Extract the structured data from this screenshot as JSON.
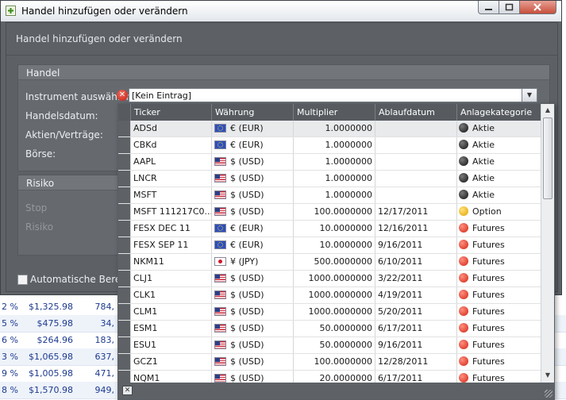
{
  "window": {
    "title": "Handel hinzufügen oder verändern",
    "header": "Handel hinzufügen oder verändern"
  },
  "groups": {
    "handel": {
      "title": "Handel",
      "instrument_label": "Instrument auswählen:",
      "date_label": "Handelsdatum:",
      "shares_label": "Aktien/Verträge:",
      "exchange_label": "Börse:"
    },
    "risiko": {
      "title": "Risiko",
      "stop_label": "Stop",
      "risk_label": "Risiko"
    }
  },
  "auto_calc_label": "Automatische Berechnu",
  "instrument_value": "[Kein Eintrag]",
  "columns": [
    "Ticker",
    "Währung",
    "Multiplier",
    "Ablaufdatum",
    "Anlagekategorie"
  ],
  "rows": [
    {
      "ticker": "ADSd",
      "flag": "eu",
      "currency": "€ (EUR)",
      "multiplier": "1.0000000",
      "expiry": "",
      "category": "Aktie",
      "cat_color": "black"
    },
    {
      "ticker": "CBKd",
      "flag": "eu",
      "currency": "€ (EUR)",
      "multiplier": "1.0000000",
      "expiry": "",
      "category": "Aktie",
      "cat_color": "black"
    },
    {
      "ticker": "AAPL",
      "flag": "us",
      "currency": "$ (USD)",
      "multiplier": "1.0000000",
      "expiry": "",
      "category": "Aktie",
      "cat_color": "black"
    },
    {
      "ticker": "LNCR",
      "flag": "us",
      "currency": "$ (USD)",
      "multiplier": "1.0000000",
      "expiry": "",
      "category": "Aktie",
      "cat_color": "black"
    },
    {
      "ticker": "MSFT",
      "flag": "us",
      "currency": "$ (USD)",
      "multiplier": "1.0000000",
      "expiry": "",
      "category": "Aktie",
      "cat_color": "black"
    },
    {
      "ticker": "MSFT  111217C0...",
      "flag": "us",
      "currency": "$ (USD)",
      "multiplier": "100.0000000",
      "expiry": "12/17/2011",
      "category": "Option",
      "cat_color": "yellow"
    },
    {
      "ticker": "FESX DEC 11",
      "flag": "eu",
      "currency": "€ (EUR)",
      "multiplier": "10.0000000",
      "expiry": "12/16/2011",
      "category": "Futures",
      "cat_color": "red"
    },
    {
      "ticker": "FESX SEP 11",
      "flag": "eu",
      "currency": "€ (EUR)",
      "multiplier": "10.0000000",
      "expiry": "9/16/2011",
      "category": "Futures",
      "cat_color": "red"
    },
    {
      "ticker": "NKM11",
      "flag": "jp",
      "currency": "¥ (JPY)",
      "multiplier": "500.0000000",
      "expiry": "6/10/2011",
      "category": "Futures",
      "cat_color": "red"
    },
    {
      "ticker": "CLJ1",
      "flag": "us",
      "currency": "$ (USD)",
      "multiplier": "1000.0000000",
      "expiry": "3/22/2011",
      "category": "Futures",
      "cat_color": "red"
    },
    {
      "ticker": "CLK1",
      "flag": "us",
      "currency": "$ (USD)",
      "multiplier": "1000.0000000",
      "expiry": "4/19/2011",
      "category": "Futures",
      "cat_color": "red"
    },
    {
      "ticker": "CLM1",
      "flag": "us",
      "currency": "$ (USD)",
      "multiplier": "1000.0000000",
      "expiry": "5/20/2011",
      "category": "Futures",
      "cat_color": "red"
    },
    {
      "ticker": "ESM1",
      "flag": "us",
      "currency": "$ (USD)",
      "multiplier": "50.0000000",
      "expiry": "6/17/2011",
      "category": "Futures",
      "cat_color": "red"
    },
    {
      "ticker": "ESU1",
      "flag": "us",
      "currency": "$ (USD)",
      "multiplier": "50.0000000",
      "expiry": "9/16/2011",
      "category": "Futures",
      "cat_color": "red"
    },
    {
      "ticker": "GCZ1",
      "flag": "us",
      "currency": "$ (USD)",
      "multiplier": "100.0000000",
      "expiry": "12/28/2011",
      "category": "Futures",
      "cat_color": "red"
    },
    {
      "ticker": "NQM1",
      "flag": "us",
      "currency": "$ (USD)",
      "multiplier": "20.0000000",
      "expiry": "6/17/2011",
      "category": "Futures",
      "cat_color": "red"
    }
  ],
  "background_rows": [
    {
      "pct": "2 %",
      "amount": "$1,325.98",
      "amount2": "784,"
    },
    {
      "pct": "5 %",
      "amount": "$475.98",
      "amount2": "34,"
    },
    {
      "pct": "6 %",
      "amount": "$264.96",
      "amount2": "183,"
    },
    {
      "pct": "3 %",
      "amount": "$1,065.98",
      "amount2": "637,"
    },
    {
      "pct": "9 %",
      "amount": "$1,005.98",
      "amount2": "471,"
    },
    {
      "pct": "8 %",
      "amount": "$1,570.98",
      "amount2": "949,"
    }
  ]
}
